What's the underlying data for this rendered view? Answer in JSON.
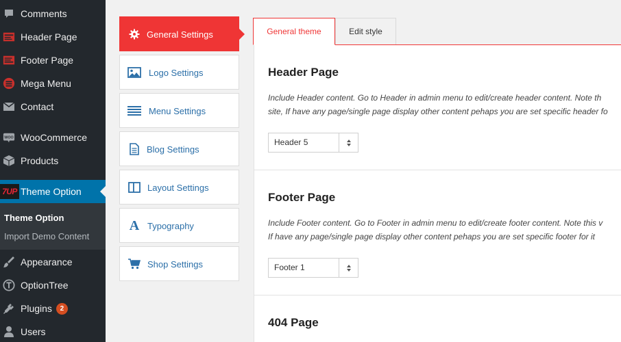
{
  "sidebar": {
    "items": [
      {
        "label": "Comments",
        "icon": "comment-bubble-icon"
      },
      {
        "label": "Header Page",
        "icon": "header-page-icon"
      },
      {
        "label": "Footer Page",
        "icon": "footer-page-icon"
      },
      {
        "label": "Mega Menu",
        "icon": "mega-menu-icon"
      },
      {
        "label": "Contact",
        "icon": "envelope-icon"
      },
      {
        "label": "WooCommerce",
        "icon": "woocommerce-icon"
      },
      {
        "label": "Products",
        "icon": "cube-icon"
      },
      {
        "label": "Theme Option",
        "icon": "7up-logo-icon",
        "logo_text": "7UP"
      },
      {
        "label": "Appearance",
        "icon": "paintbrush-icon"
      },
      {
        "label": "OptionTree",
        "icon": "optiontree-icon"
      },
      {
        "label": "Plugins",
        "icon": "plug-icon",
        "badge": "2"
      },
      {
        "label": "Users",
        "icon": "user-icon"
      }
    ],
    "submenu": [
      {
        "label": "Theme Option"
      },
      {
        "label": "Import Demo Content"
      }
    ]
  },
  "settings_nav": {
    "items": [
      {
        "label": "General Settings",
        "icon": "gear-icon"
      },
      {
        "label": "Logo Settings",
        "icon": "image-icon"
      },
      {
        "label": "Menu Settings",
        "icon": "menu-lines-icon"
      },
      {
        "label": "Blog Settings",
        "icon": "document-icon"
      },
      {
        "label": "Layout Settings",
        "icon": "columns-icon"
      },
      {
        "label": "Typography",
        "icon": "typography-icon",
        "glyph": "A"
      },
      {
        "label": "Shop Settings",
        "icon": "cart-icon"
      }
    ]
  },
  "tabs": [
    {
      "label": "General theme"
    },
    {
      "label": "Edit style"
    }
  ],
  "content": {
    "sections": [
      {
        "title": "Header Page",
        "desc_line1": "Include Header content. Go to Header in admin menu to edit/create header content. Note th",
        "desc_line2": "site, If have any page/single page display other content pehaps you are set specific header fo",
        "select_value": "Header 5"
      },
      {
        "title": "Footer Page",
        "desc_line1": "Include Footer content. Go to Footer in admin menu to edit/create footer content. Note this v",
        "desc_line2": "If have any page/single page display other content pehaps you are set specific footer for it",
        "select_value": "Footer 1"
      },
      {
        "title": "404 Page"
      }
    ]
  },
  "colors": {
    "sidebar_bg": "#23282d",
    "sidebar_active": "#0073aa",
    "accent_red": "#ef3535",
    "link_blue": "#2b6fa8",
    "badge": "#d54e21"
  }
}
